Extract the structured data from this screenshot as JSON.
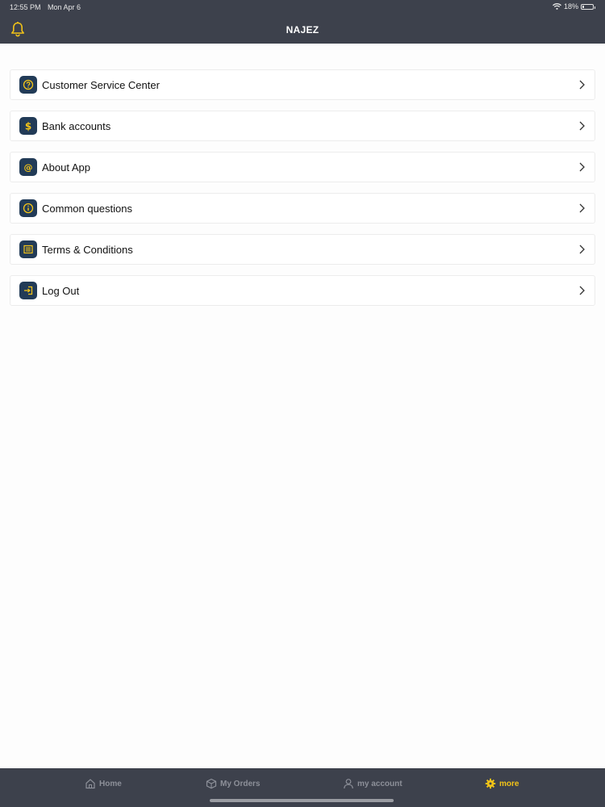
{
  "status": {
    "time": "12:55 PM",
    "date": "Mon Apr 6",
    "battery": "18%"
  },
  "header": {
    "title": "NAJEZ",
    "bell_icon": "bell-icon"
  },
  "menu": [
    {
      "label": "Customer Service Center",
      "icon": "question-icon"
    },
    {
      "label": "Bank accounts",
      "icon": "dollar-icon"
    },
    {
      "label": "About App",
      "icon": "at-icon"
    },
    {
      "label": "Common questions",
      "icon": "info-icon"
    },
    {
      "label": "Terms & Conditions",
      "icon": "document-icon"
    },
    {
      "label": "Log Out",
      "icon": "logout-icon"
    }
  ],
  "tabs": [
    {
      "label": "Home",
      "icon": "home-icon",
      "active": false
    },
    {
      "label": "My Orders",
      "icon": "box-icon",
      "active": false
    },
    {
      "label": "my account",
      "icon": "user-icon",
      "active": false
    },
    {
      "label": "more",
      "icon": "gear-icon",
      "active": true
    }
  ],
  "colors": {
    "bar": "#3d414c",
    "accent": "#f2c318",
    "icon_bg": "#223b57"
  }
}
